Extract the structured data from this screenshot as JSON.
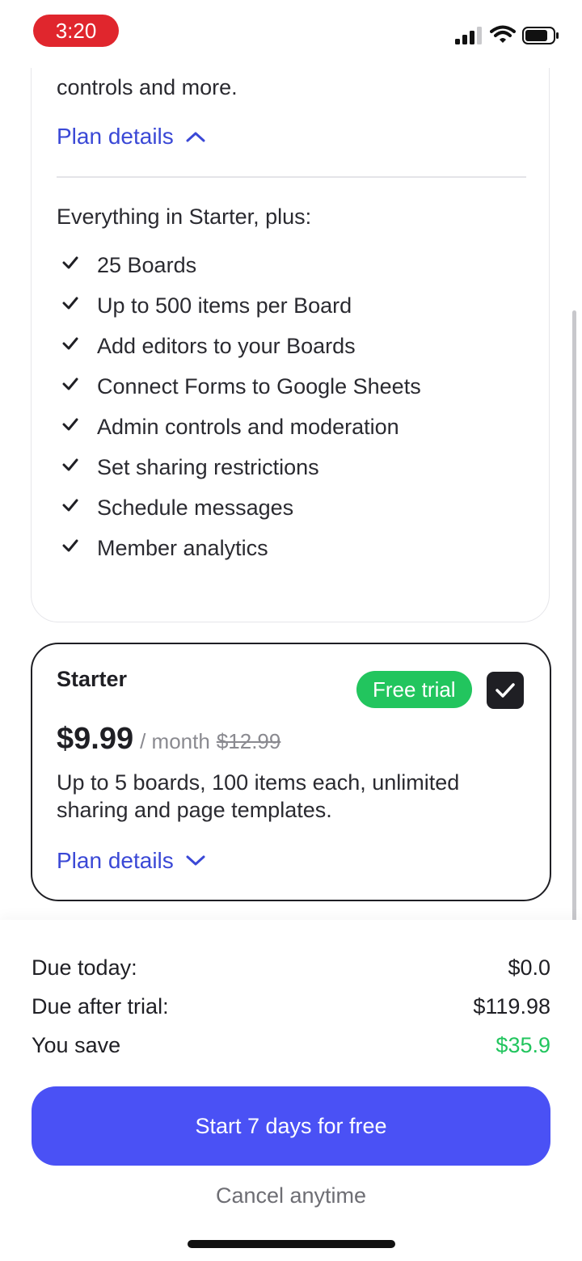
{
  "status_bar": {
    "time": "3:20"
  },
  "expanded_plan": {
    "description_tail": "controls and more.",
    "plan_details_label": "Plan details",
    "features_heading": "Everything in Starter, plus:",
    "features": [
      "25 Boards",
      "Up to 500 items per Board",
      "Add editors to your Boards",
      "Connect Forms to Google Sheets",
      "Admin controls and moderation",
      "Set sharing restrictions",
      "Schedule messages",
      "Member analytics"
    ]
  },
  "starter_plan": {
    "name": "Starter",
    "badge": "Free trial",
    "selected": true,
    "price": "$9.99",
    "period": "/ month",
    "old_price": "$12.99",
    "description": "Up to 5 boards, 100 items each, unlimited sharing and page templates.",
    "plan_details_label": "Plan details"
  },
  "summary": {
    "due_today_label": "Due today:",
    "due_today_value": "$0.0",
    "due_after_label": "Due after trial:",
    "due_after_value": "$119.98",
    "save_label": "You save",
    "save_value": "$35.9"
  },
  "cta": {
    "button_label": "Start 7 days for free",
    "cancel_note": "Cancel anytime"
  },
  "colors": {
    "accent": "#4a51f5",
    "link": "#3a48d6",
    "success": "#22c55e",
    "time_pill": "#e0262d"
  },
  "icons": [
    "signal-icon",
    "wifi-icon",
    "battery-icon",
    "chevron-up-icon",
    "chevron-down-icon",
    "check-icon",
    "checkbox-checked-icon"
  ]
}
